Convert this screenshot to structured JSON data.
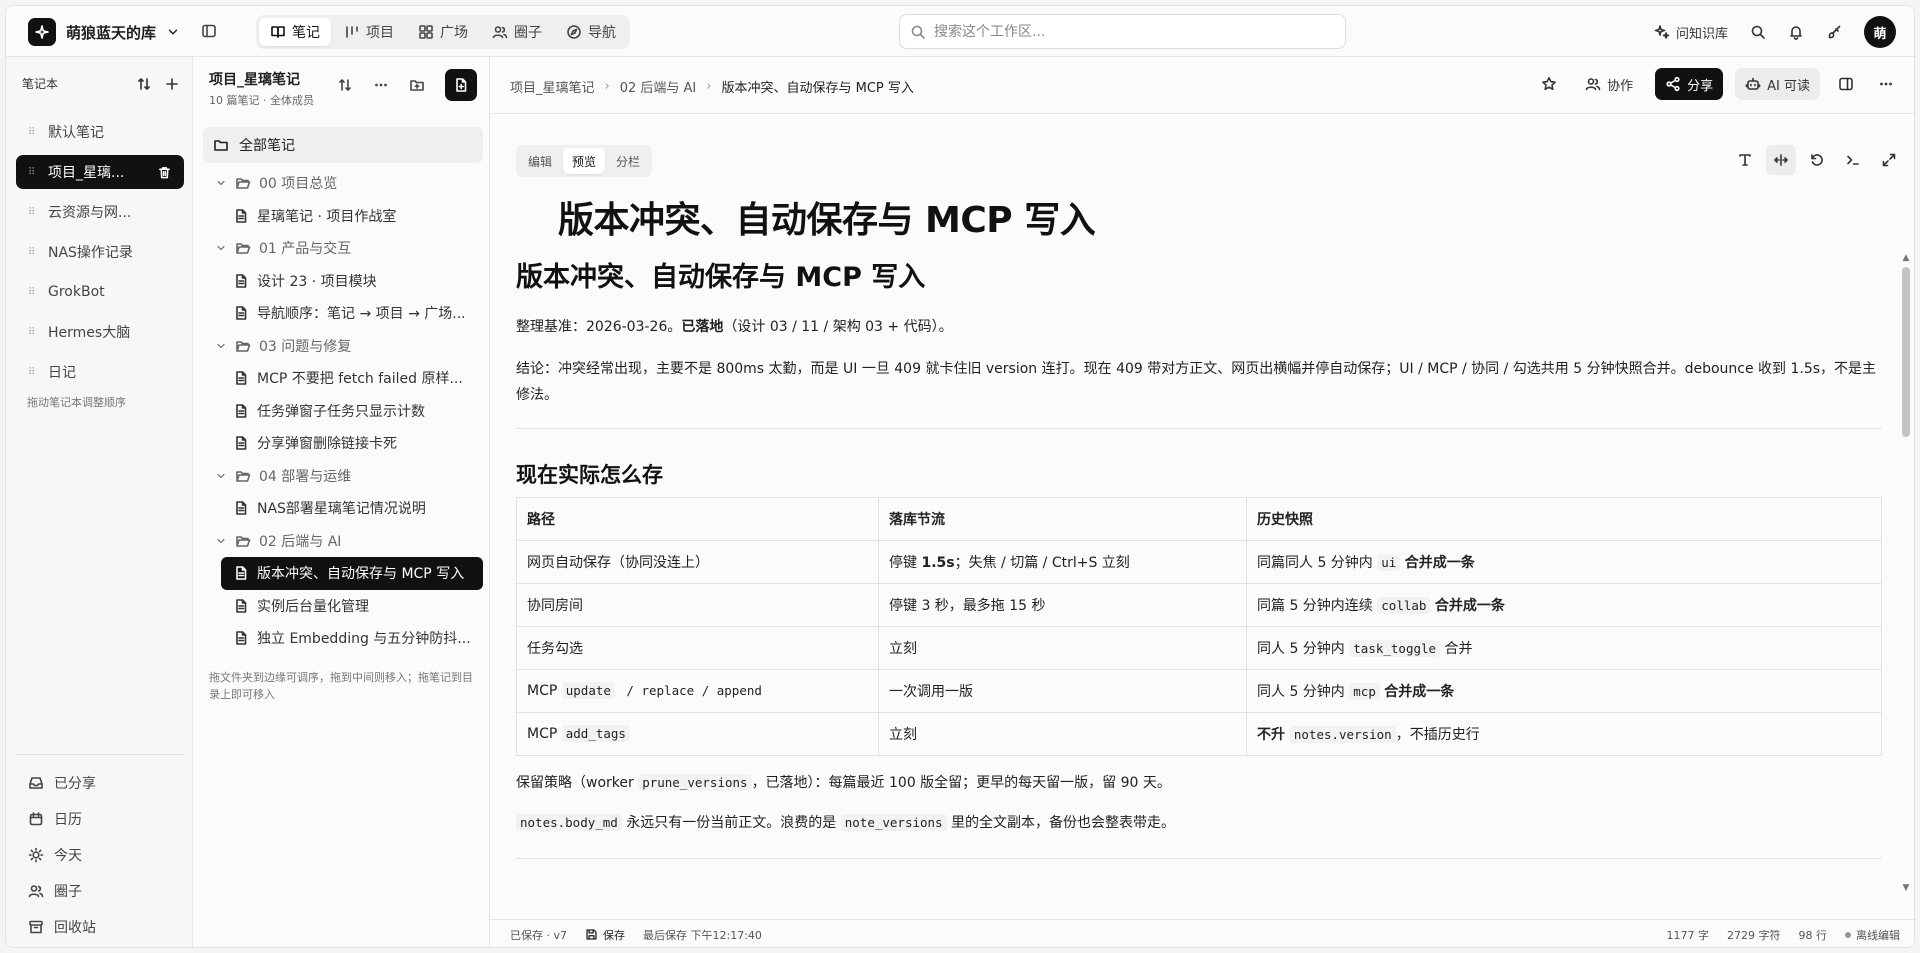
{
  "app": {
    "workspace_name": "萌狼蓝天的库",
    "nav_tabs": [
      "笔记",
      "项目",
      "广场",
      "圈子",
      "导航"
    ],
    "search_placeholder": "搜索这个工作区...",
    "ask_kb": "问知识库",
    "avatar_initial": "萌"
  },
  "sidebar": {
    "header": "笔记本",
    "notebooks": [
      "默认笔记",
      "项目_星璃...",
      "云资源与网...",
      "NAS操作记录",
      "GrokBot",
      "Hermes大脑",
      "日记"
    ],
    "active_index": 1,
    "hint": "拖动笔记本调整顺序",
    "bottom": [
      "已分享",
      "日历",
      "今天",
      "圈子",
      "回收站"
    ]
  },
  "tree": {
    "title": "项目_星璃笔记",
    "subtitle": "10 篇笔记 · 全体成员",
    "all_notes": "全部笔记",
    "rows": [
      {
        "type": "folder",
        "label": "00 项目总览"
      },
      {
        "type": "file",
        "label": "星璃笔记 · 项目作战室"
      },
      {
        "type": "folder",
        "label": "01 产品与交互"
      },
      {
        "type": "file",
        "label": "设计 23 · 项目模块"
      },
      {
        "type": "file",
        "label": "导航顺序：笔记 → 项目 → 广场..."
      },
      {
        "type": "folder",
        "label": "03 问题与修复"
      },
      {
        "type": "file",
        "label": "MCP 不要把 fetch failed 原样..."
      },
      {
        "type": "file",
        "label": "任务弹窗子任务只显示计数"
      },
      {
        "type": "file",
        "label": "分享弹窗删除链接卡死"
      },
      {
        "type": "folder",
        "label": "04 部署与运维"
      },
      {
        "type": "file",
        "label": "NAS部署星璃笔记情况说明"
      },
      {
        "type": "folder",
        "label": "02 后端与 AI"
      },
      {
        "type": "file",
        "label": "版本冲突、自动保存与 MCP 写入",
        "active": true
      },
      {
        "type": "file",
        "label": "实例后台量化管理"
      },
      {
        "type": "file",
        "label": "独立 Embedding 与五分钟防抖..."
      }
    ],
    "hint": "拖文件夹到边缘可调序，拖到中间则移入；拖笔记到目录上即可移入"
  },
  "main": {
    "breadcrumb": [
      "项目_星璃笔记",
      "02 后端与 AI",
      "版本冲突、自动保存与 MCP 写入"
    ],
    "actions": {
      "collab": "协作",
      "share": "分享",
      "ai_read": "AI 可读"
    },
    "mode_tabs": [
      "编辑",
      "预览",
      "分栏"
    ],
    "active_mode": 1,
    "title": "版本冲突、自动保存与 MCP 写入",
    "h1": "版本冲突、自动保存与 MCP 写入",
    "p1_a": "整理基准：2026-03-26。",
    "p1_b": "已落地",
    "p1_c": "（设计 03 / 11 / 架构 03 + 代码）。",
    "p2": "结论：冲突经常出现，主要不是 800ms 太勤，而是 UI 一旦 409 就卡住旧 version 连打。现在 409 带对方正文、网页出横幅并停自动保存；UI / MCP / 协同 / 勾选共用 5 分钟快照合并。debounce 收到 1.5s，不是主修法。",
    "h2": "现在实际怎么存",
    "table": {
      "headers": [
        "路径",
        "落库节流",
        "历史快照"
      ],
      "rows": [
        {
          "path_a": "网页自动保存（协同没连上）",
          "path_code": "",
          "path_b": "",
          "t_a": "停键 ",
          "t_b": "1.5s",
          "t_c": "；失焦 / 切篇 / Ctrl+S 立刻",
          "h_a": "同篇同人 5 分钟内 ",
          "h_code": "ui",
          "h_b": "合并成一条",
          "h_c": ""
        },
        {
          "path_a": "协同房间",
          "path_code": "",
          "path_b": "",
          "t_a": "停键 3 秒，最多拖 15 秒",
          "t_b": "",
          "t_c": "",
          "h_a": "同篇 5 分钟内连续 ",
          "h_code": "collab",
          "h_b": "合并成一条",
          "h_c": ""
        },
        {
          "path_a": "任务勾选",
          "path_code": "",
          "path_b": "",
          "t_a": "立刻",
          "t_b": "",
          "t_c": "",
          "h_a": "同人 5 分钟内 ",
          "h_code": "task_toggle",
          "h_b": "",
          "h_c": " 合并"
        },
        {
          "path_a": "MCP ",
          "path_code": "update",
          "path_b": " / replace / append",
          "t_a": "一次调用一版",
          "t_b": "",
          "t_c": "",
          "h_a": "同人 5 分钟内 ",
          "h_code": "mcp",
          "h_b": "合并成一条",
          "h_c": ""
        },
        {
          "path_a": "MCP ",
          "path_code": "add_tags",
          "path_b": "",
          "t_a": "立刻",
          "t_b": "",
          "t_c": "",
          "h_a": "",
          "h_code": "notes.version",
          "h_b": "",
          "h_c": "，不插历史行",
          "h_pre_bold": "不升 "
        }
      ]
    },
    "p3_a": "保留策略（worker ",
    "p3_code": "prune_versions",
    "p3_b": "，已落地）：每篇最近 100 版全留；更早的每天留一版，留 90 天。",
    "p4_code1": "notes.body_md",
    "p4_a": " 永远只有一份当前正文。浪费的是 ",
    "p4_code2": "note_versions",
    "p4_b": " 里的全文副本，备份也会整表带走。"
  },
  "status": {
    "saved": "已保存 · v7",
    "save": "保存",
    "last_saved": "最后保存 下午12:17:40",
    "words": "1177 字",
    "chars": "2729 字符",
    "lines": "98 行",
    "offline": "离线编辑"
  }
}
